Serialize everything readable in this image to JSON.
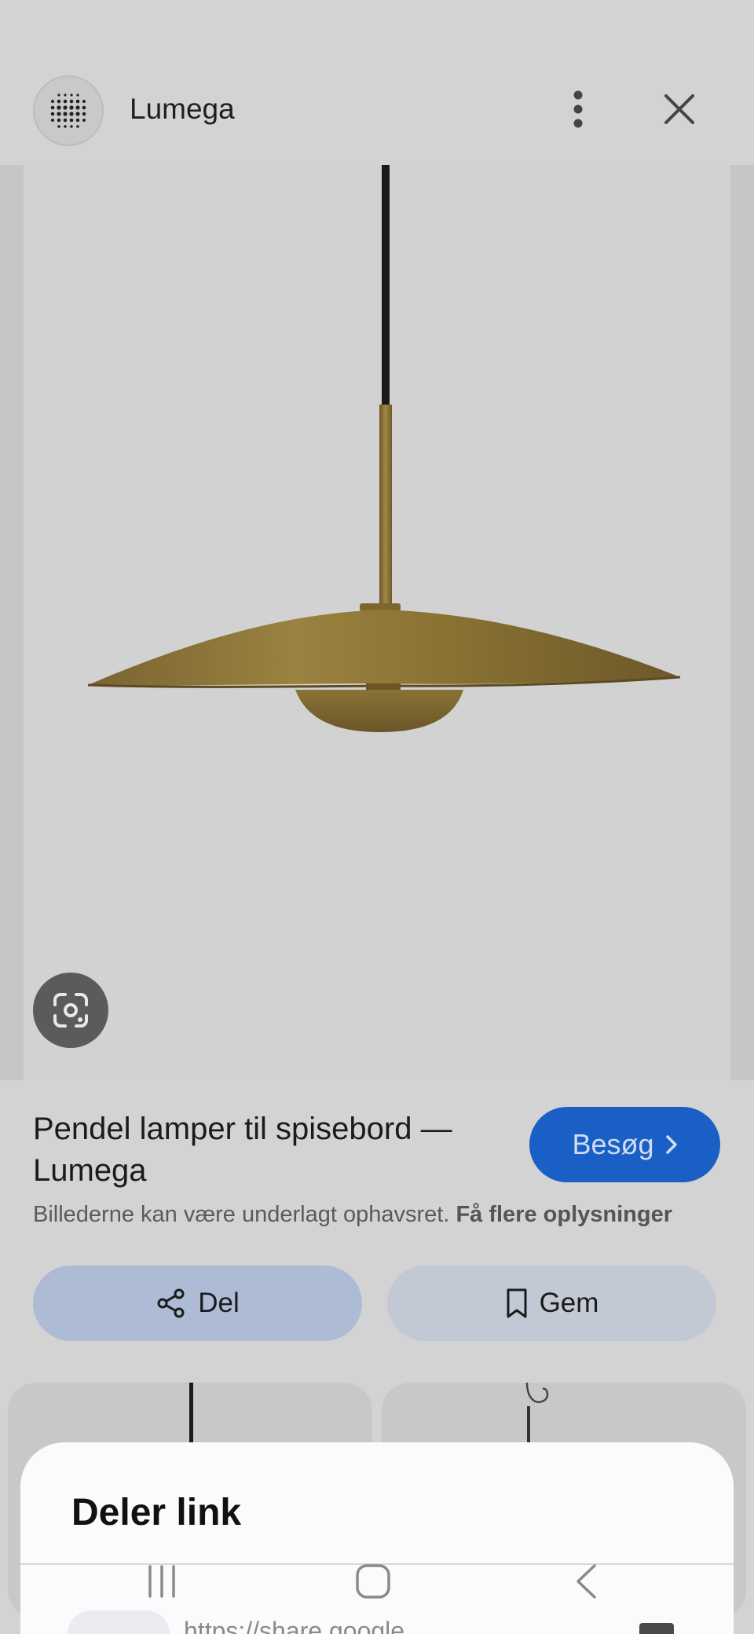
{
  "header": {
    "site_name": "Lumega",
    "logo_icon": "dot-grid-logo",
    "more_icon": "more-vert-icon",
    "close_icon": "close-icon"
  },
  "image": {
    "subject": "brass-pendant-lamp",
    "lens_icon": "google-lens-icon"
  },
  "result": {
    "title": "Pendel lamper til spisebord — Lumega",
    "visit_label": "Besøg",
    "copyright_text": "Billederne kan være underlagt ophavsret.",
    "more_info_link": "Få flere oplysninger",
    "share_label": "Del",
    "save_label": "Gem"
  },
  "sheet": {
    "title": "Deler link",
    "url_partial": "https://share.google"
  },
  "nav": {
    "recent_icon": "recent-apps-icon",
    "home_icon": "home-icon",
    "back_icon": "back-icon"
  },
  "colors": {
    "accent": "#1a5fc6",
    "background": "#d3d3d3",
    "share_button": "#adbbd4",
    "save_button": "#c2c8d4",
    "brass": "#8a7233"
  }
}
